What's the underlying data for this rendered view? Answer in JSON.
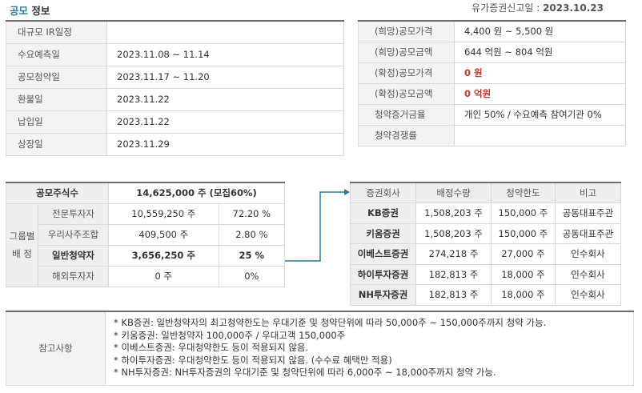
{
  "header": {
    "title_accent": "공모",
    "title_rest": " 정보",
    "report_label": "유가증권신고일 : ",
    "report_date": "2023.10.23"
  },
  "schedule": [
    {
      "label": "대규모 IR일정",
      "value": ""
    },
    {
      "label": "수요예측일",
      "value": "2023.11.08 ~ 11.14"
    },
    {
      "label": "공모청약일",
      "value": "2023.11.17 ~ 11.20"
    },
    {
      "label": "환불일",
      "value": "2023.11.22"
    },
    {
      "label": "납입일",
      "value": "2023.11.22"
    },
    {
      "label": "상장일",
      "value": "2023.11.29"
    }
  ],
  "price": [
    {
      "label": "(희망)공모가격",
      "value": "4,400 원 ~ 5,500 원",
      "highlight": false
    },
    {
      "label": "(희망)공모금액",
      "value": "644 억원  ~ 804 억원",
      "highlight": false
    },
    {
      "label": "(확정)공모가격",
      "value": "0 원",
      "highlight": true
    },
    {
      "label": "(확정)공모금액",
      "value": "0 억원",
      "highlight": true
    },
    {
      "label": "청약증거금율",
      "value": "개인 50% / 수요예측 참여기관 0%",
      "highlight": false
    },
    {
      "label": "청약경쟁률",
      "value": "",
      "highlight": false
    }
  ],
  "shares": {
    "total_label": "공모주식수",
    "total_value": "14,625,000 주 (모집60%)",
    "group_label_line1": "그룹별",
    "group_label_line2": "배 정",
    "rows": [
      {
        "category": "전문투자자",
        "shares": "10,559,250 주",
        "pct": "72.20 %"
      },
      {
        "category": "우리사주조합",
        "shares": "409,500 주",
        "pct": "2.80 %"
      },
      {
        "category": "일반청약자",
        "shares": "3,656,250 주",
        "pct": "25 %"
      },
      {
        "category": "해외투자자",
        "shares": "0 주",
        "pct": "0%"
      }
    ]
  },
  "brokers": {
    "headers": [
      "증권회사",
      "배정수량",
      "청약한도",
      "비고"
    ],
    "rows": [
      {
        "firm": "KB증권",
        "allotment": "1,508,203 주",
        "limit": "150,000 주",
        "note": "공동대표주관"
      },
      {
        "firm": "키움증권",
        "allotment": "1,508,203 주",
        "limit": "150,000 주",
        "note": "공동대표주관"
      },
      {
        "firm": "이베스트증권",
        "allotment": "274,218 주",
        "limit": "27,000 주",
        "note": "인수회사"
      },
      {
        "firm": "하이투자증권",
        "allotment": "182,813 주",
        "limit": "18,000 주",
        "note": "인수회사"
      },
      {
        "firm": "NH투자증권",
        "allotment": "182,813 주",
        "limit": "18,000 주",
        "note": "인수회사"
      }
    ]
  },
  "notes": {
    "label": "참고사항",
    "items": [
      "* KB증권: 일반청약자의 최고청약한도는 우대기준 및 청약단위에 따라 50,000주 ~ 150,000주까지 청약 가능.",
      "* 키움증권: 일반청약자 100,000주 / 우대고객 150,000주",
      "* 이베스트증권: 우대청약한도 등이 적용되지 않음.",
      "* 하이투자증권: 우대청약한도 등이 적용되지 않음. (수수료 혜택만 적용)",
      "* NH투자증권: NH투자증권의 우대기준 및 청약단위에 따라 6,000주 ~ 18,000주까지 청약 가능."
    ]
  },
  "colors": {
    "accent": "#2b7a9c",
    "highlight_red": "#c0392b",
    "label_bg": "#f3f3f3",
    "border": "#d9d9d9"
  }
}
